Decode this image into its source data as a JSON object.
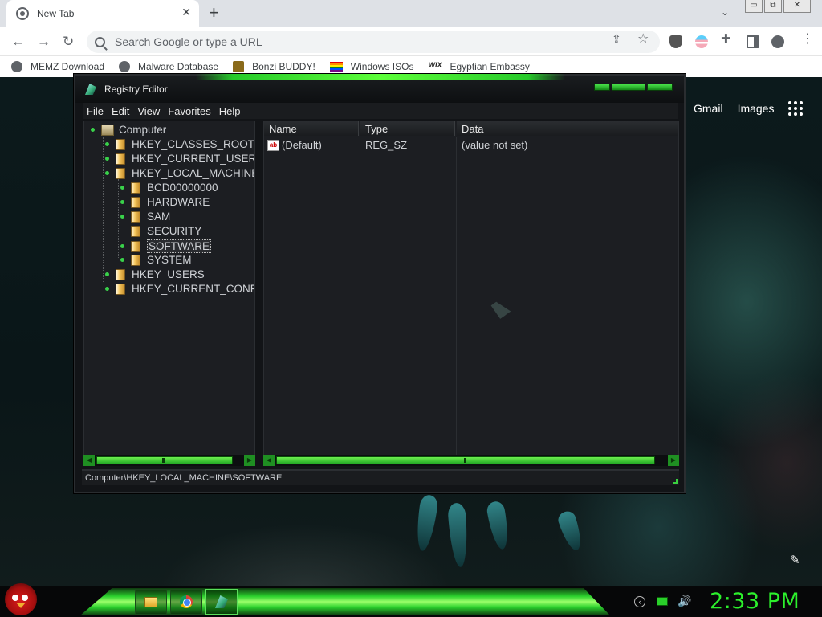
{
  "browser": {
    "tab_title": "New Tab",
    "tab_close": "✕",
    "new_tab": "+",
    "tab_menu": "⌄",
    "window_buttons": [
      "▭",
      "⧉",
      "✕"
    ],
    "omnibox_placeholder": "Search Google or type a URL",
    "bookmarks": [
      {
        "label": "MEMZ Download",
        "icon": "globe-icon"
      },
      {
        "label": "Malware Database",
        "icon": "globe-icon"
      },
      {
        "label": "Bonzi BUDDY!",
        "icon": "bonzi-icon"
      },
      {
        "label": "Windows ISOs",
        "icon": "rainbow-flag-icon"
      },
      {
        "label": "Egyptian Embassy",
        "icon": "wix-icon",
        "icon_text": "WIX"
      }
    ]
  },
  "google": {
    "gmail": "Gmail",
    "images": "Images"
  },
  "registry": {
    "title": "Registry Editor",
    "menu": [
      "File",
      "Edit",
      "View",
      "Favorites",
      "Help"
    ],
    "tree": {
      "root": "Computer",
      "hives": [
        "HKEY_CLASSES_ROOT",
        "HKEY_CURRENT_USER",
        "HKEY_LOCAL_MACHINE"
      ],
      "hklm_children": [
        "BCD00000000",
        "HARDWARE",
        "SAM",
        "SECURITY",
        "SOFTWARE",
        "SYSTEM"
      ],
      "hives_after": [
        "HKEY_USERS",
        "HKEY_CURRENT_CONFI"
      ],
      "selected": "SOFTWARE"
    },
    "columns": [
      "Name",
      "Type",
      "Data"
    ],
    "values": [
      {
        "name": "(Default)",
        "type": "REG_SZ",
        "data": "(value not set)",
        "icon_text": "ab"
      }
    ],
    "status_path": "Computer\\HKEY_LOCAL_MACHINE\\SOFTWARE"
  },
  "taskbar": {
    "clock": "2:33 PM",
    "buttons": [
      "file-explorer",
      "chrome",
      "registry-editor"
    ],
    "active": "registry-editor"
  }
}
